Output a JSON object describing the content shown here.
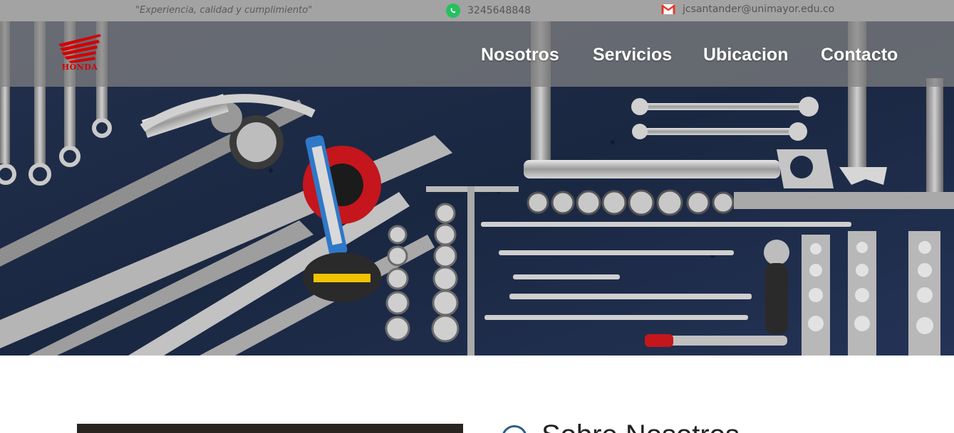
{
  "topbar": {
    "slogan": "\"Experiencia, calidad y cumplimiento\"",
    "phone": "3245648848",
    "phone_icon": "whatsapp-icon",
    "email": "jcsantander@unimayor.edu.co",
    "email_icon": "gmail-icon"
  },
  "brand": {
    "logo_text": "HONDA",
    "color": "#d40000"
  },
  "nav": {
    "items": [
      "Nosotros",
      "Servicios",
      "Ubicacion",
      "Contacto"
    ]
  },
  "hero": {
    "image": "tools-on-pegboard"
  },
  "about": {
    "title": "Sobre Nosotros",
    "icon": "circle-icon"
  },
  "colors": {
    "topbar": "#a3a3a3",
    "navbar": "#828282",
    "hero_bg": "#1d2a45",
    "nav_text": "#ffffff",
    "accent_red": "#d40000"
  }
}
